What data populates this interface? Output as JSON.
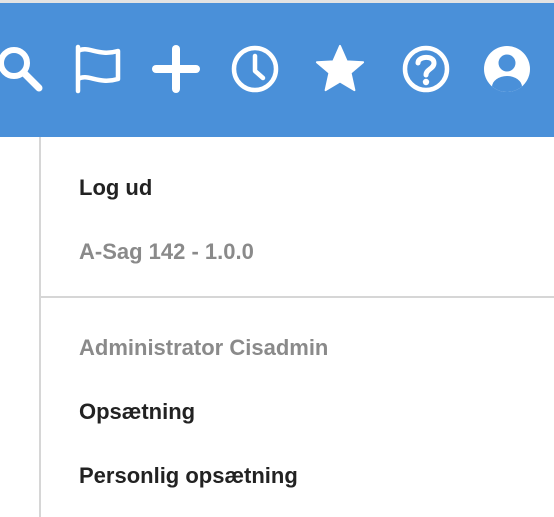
{
  "toolbar": {
    "background": "#4a90d9",
    "icons": [
      "search-icon",
      "flag-icon",
      "plus-icon",
      "clock-icon",
      "star-icon",
      "help-icon",
      "user-icon"
    ]
  },
  "menu": {
    "logout_label": "Log ud",
    "version_text": "A-Sag 142 - 1.0.0",
    "user_name": "Administrator Cisadmin",
    "setup_label": "Opsætning",
    "personal_setup_label": "Personlig opsætning"
  }
}
